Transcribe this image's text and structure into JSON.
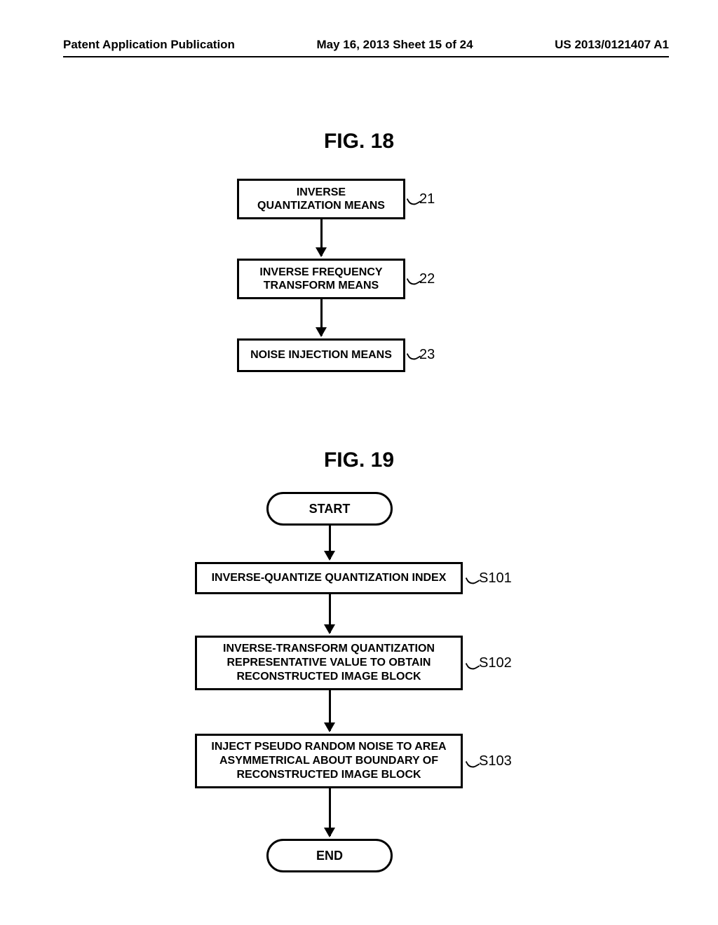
{
  "header": {
    "left": "Patent Application Publication",
    "center": "May 16, 2013  Sheet 15 of 24",
    "right": "US 2013/0121407 A1"
  },
  "fig18": {
    "title": "FIG. 18",
    "boxes": {
      "a": {
        "text": "INVERSE\nQUANTIZATION MEANS",
        "ref": "21"
      },
      "b": {
        "text": "INVERSE FREQUENCY\nTRANSFORM MEANS",
        "ref": "22"
      },
      "c": {
        "text": "NOISE INJECTION MEANS",
        "ref": "23"
      }
    }
  },
  "fig19": {
    "title": "FIG. 19",
    "start": "START",
    "end": "END",
    "steps": {
      "a": {
        "text": "INVERSE-QUANTIZE QUANTIZATION INDEX",
        "ref": "S101"
      },
      "b": {
        "text": "INVERSE-TRANSFORM QUANTIZATION\nREPRESENTATIVE VALUE TO OBTAIN\nRECONSTRUCTED IMAGE BLOCK",
        "ref": "S102"
      },
      "c": {
        "text": "INJECT PSEUDO RANDOM NOISE TO AREA\nASYMMETRICAL ABOUT BOUNDARY OF\nRECONSTRUCTED IMAGE BLOCK",
        "ref": "S103"
      }
    }
  }
}
